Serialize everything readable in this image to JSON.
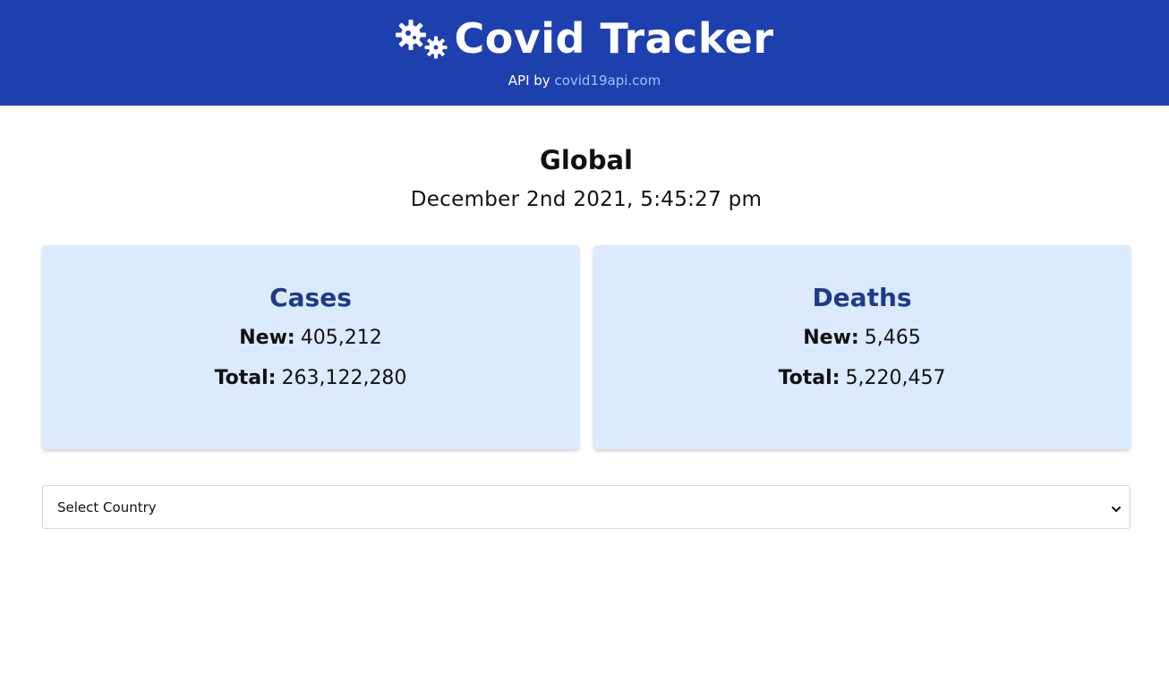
{
  "header": {
    "title": "Covid Tracker",
    "api_prefix": "API by",
    "api_link": "covid19api.com"
  },
  "summary": {
    "region": "Global",
    "date": "December 2nd 2021, 5:45:27 pm"
  },
  "cards": [
    {
      "title": "Cases",
      "new_label": "New:",
      "new_value": "405,212",
      "total_label": "Total:",
      "total_value": "263,122,280"
    },
    {
      "title": "Deaths",
      "new_label": "New:",
      "new_value": "5,465",
      "total_label": "Total:",
      "total_value": "5,220,457"
    }
  ],
  "country_select": {
    "selected": "Select Country"
  },
  "icons": {
    "logo": "virus-icon",
    "select_arrow": "chevron-down-icon"
  },
  "colors": {
    "header_bg": "#1e40af",
    "link": "#93c5fd",
    "card_bg": "#dbeafe",
    "card_title": "#1e3a8a"
  }
}
